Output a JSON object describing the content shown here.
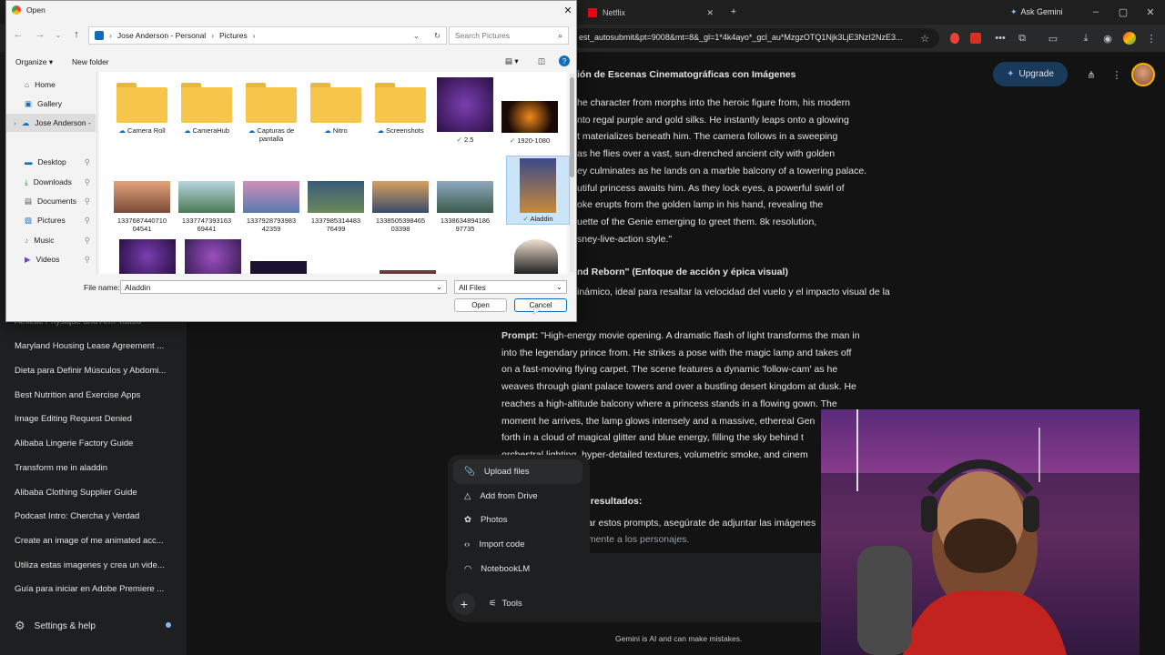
{
  "browser": {
    "tabs": [
      {
        "label": "Netflix"
      }
    ],
    "url": "est_autosubmit&pt=9008&mt=8&_gl=1*4k4ayo*_gcl_au*MzgzOTQ1Njk3LjE3NzI2NzE3...",
    "ask_gemini": "Ask Gemini"
  },
  "gemini": {
    "upgrade": "Upgrade",
    "history": [
      "Athletic Physique and Arm Tattoo",
      "Maryland Housing Lease Agreement ...",
      "Dieta para Definir Músculos y Abdomi...",
      "Best Nutrition and Exercise Apps",
      "Image Editing Request Denied",
      "Alibaba Lingerie Factory Guide",
      "Transform me in aladdin",
      "Alibaba Clothing Supplier Guide",
      "Podcast Intro: Chercha y Verdad",
      "Create an image of me animated acc...",
      "Utiliza estas imagenes y crea un vide...",
      "Guía para iniciar en Adobe Premiere ..."
    ],
    "settings": "Settings & help",
    "heading1": "ión de Escenas Cinematográficas con Imágenes",
    "para1": [
      "he character from morphs into the heroic figure from, his modern",
      "nto regal purple and gold silks. He instantly leaps onto a glowing",
      "t materializes beneath him. The camera follows in a sweeping",
      "as he flies over a vast, sun-drenched ancient city with golden",
      "ey culminates as he lands on a marble balcony of a towering palace.",
      "utiful princess awaits him. As they lock eyes, a powerful swirl of",
      "oke erupts from the golden lamp in his hand, revealing the",
      "uette of the Genie emerging to greet them. 8k resolution,",
      "sney-live-action style.\""
    ],
    "heading2": "nd Reborn\" (Enfoque de acción y épica visual)",
    "para2": "inámico, ideal para resaltar la velocidad del vuelo y el impacto visual de la",
    "prompt_label": "Prompt:",
    "para3": [
      "\"High-energy movie opening. A dramatic flash of light transforms the man in",
      "into the legendary prince from. He strikes a pose with the magic lamp and takes off",
      "on a fast-moving flying carpet. The scene features a dynamic 'follow-cam' as he",
      "weaves through giant palace towers and over a bustling desert kingdom at dusk. He",
      "reaches a high-altitude balcony where a princess stands in a flowing gown. The",
      "moment he arrives, the lamp glows intensely and a massive, ethereal Gen",
      "forth in a cloud of magical glitter and blue energy, filling the sky behind t",
      "orchestral lighting, hyper-detailed textures, volumetric smoke, and cinem"
    ],
    "heading3": "s resultados:",
    "para4": [
      "sar estos prompts, asegúrate de adjuntar las imágenes",
      "amente a los personajes."
    ],
    "menu": [
      "Upload files",
      "Add from Drive",
      "Photos",
      "Import code",
      "NotebookLM"
    ],
    "tools": "Tools",
    "disclaimer": "Gemini is AI and can make mistakes."
  },
  "dialog": {
    "title": "Open",
    "breadcrumb": [
      "Jose Anderson - Personal",
      "Pictures"
    ],
    "search_placeholder": "Search Pictures",
    "organize": "Organize",
    "new_folder": "New folder",
    "nav": [
      "Home",
      "Gallery",
      "Jose Anderson -",
      "Desktop",
      "Downloads",
      "Documents",
      "Pictures",
      "Music",
      "Videos"
    ],
    "row1": [
      {
        "name": "Camera Roll",
        "kind": "folder"
      },
      {
        "name": "CameraHub",
        "kind": "folder"
      },
      {
        "name": "Capturas de pantalla",
        "kind": "folder"
      },
      {
        "name": "Nitro",
        "kind": "folder"
      },
      {
        "name": "Screenshots",
        "kind": "folder"
      },
      {
        "name": "2.5",
        "kind": "image"
      },
      {
        "name": "1920-1080",
        "kind": "image"
      }
    ],
    "row2": [
      "1337687440710 04541",
      "1337747393163 69441",
      "1337928793983 42359",
      "1337985314483 76499",
      "1338505398465 03398",
      "1338634894186 97735",
      "Aladdin"
    ],
    "file_name_label": "File name:",
    "file_name_value": "Aladdin",
    "file_type": "All Files",
    "open": "Open",
    "cancel": "Cancel"
  }
}
